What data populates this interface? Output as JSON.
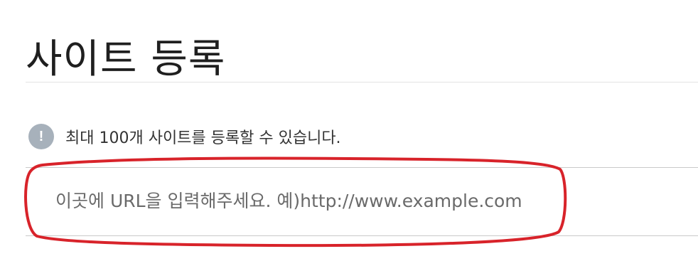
{
  "header": {
    "title": "사이트 등록"
  },
  "notice": {
    "icon": "exclamation-icon",
    "icon_glyph": "!",
    "icon_color": "#a7b1bb",
    "text": "최대 100개 사이트를 등록할 수 있습니다."
  },
  "url_input": {
    "value": "",
    "placeholder": "이곳에 URL을 입력해주세요. 예)http://www.example.com"
  },
  "annotation": {
    "type": "red-ellipse-highlight",
    "color": "#d8232a"
  }
}
